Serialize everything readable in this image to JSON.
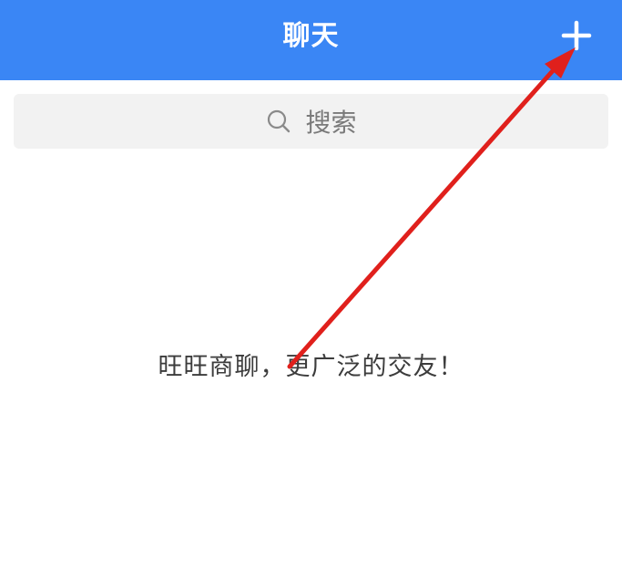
{
  "header": {
    "title": "聊天",
    "add_icon": "plus-icon"
  },
  "search": {
    "label": "搜索",
    "icon": "search-icon"
  },
  "empty_state": {
    "message": "旺旺商聊，更广泛的交友！"
  },
  "annotation": {
    "type": "arrow",
    "points_to": "add-button"
  },
  "colors": {
    "header_bg": "#3a86f5",
    "header_text": "#ffffff",
    "search_bg": "#f2f2f2",
    "search_text": "#7a7a7a",
    "body_text": "#3c3c3c",
    "arrow": "#e0201c"
  }
}
